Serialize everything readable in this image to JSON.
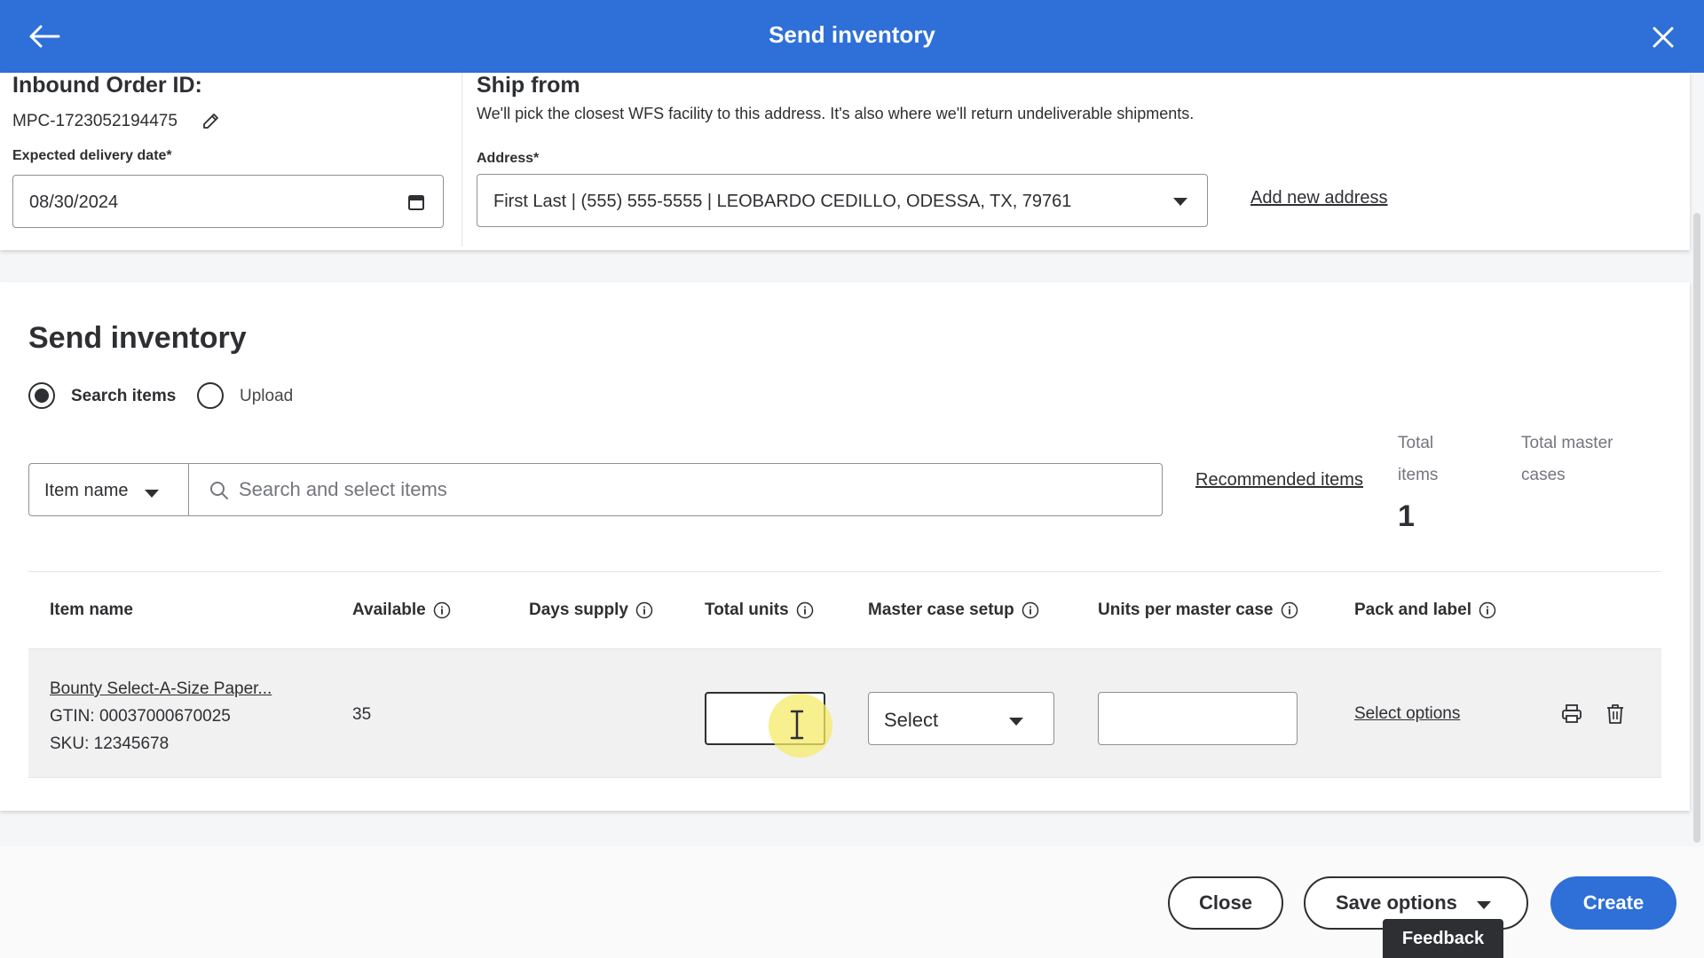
{
  "header": {
    "title": "Send inventory"
  },
  "order": {
    "id_label": "Inbound Order ID:",
    "id_value": "MPC-1723052194475",
    "date_label": "Expected delivery date*",
    "date_value": "08/30/2024"
  },
  "ship_from": {
    "title": "Ship from",
    "description": "We'll pick the closest WFS facility to this address. It's also where we'll return undeliverable shipments.",
    "address_label": "Address*",
    "address_value": "First Last | (555) 555-5555 | LEOBARDO CEDILLO, ODESSA, TX, 79761",
    "add_address_link": "Add new address"
  },
  "send_inventory": {
    "title": "Send inventory",
    "radio_search": "Search items",
    "radio_upload": "Upload",
    "filter_value": "Item name",
    "search_placeholder": "Search and select items",
    "recommended_link": "Recommended items",
    "total_items_label_1": "Total",
    "total_items_label_2": "items",
    "total_items_value": "1",
    "total_cases_label_1": "Total master",
    "total_cases_label_2": "cases"
  },
  "table": {
    "headers": {
      "item_name": "Item name",
      "available": "Available",
      "days_supply": "Days supply",
      "total_units": "Total units",
      "master_case": "Master case setup",
      "units_per_case": "Units per master case",
      "pack_label": "Pack and label"
    },
    "rows": [
      {
        "name": "Bounty Select-A-Size Paper...",
        "gtin": "GTIN: 00037000670025",
        "sku": "SKU: 12345678",
        "available": "35",
        "master_case_value": "Select",
        "pack_link": "Select options"
      }
    ]
  },
  "footer": {
    "close": "Close",
    "save_options": "Save options",
    "create": "Create",
    "feedback": "Feedback"
  },
  "colors": {
    "primary": "#2e6fd8",
    "text": "#2e2f32",
    "muted": "#74767c"
  }
}
